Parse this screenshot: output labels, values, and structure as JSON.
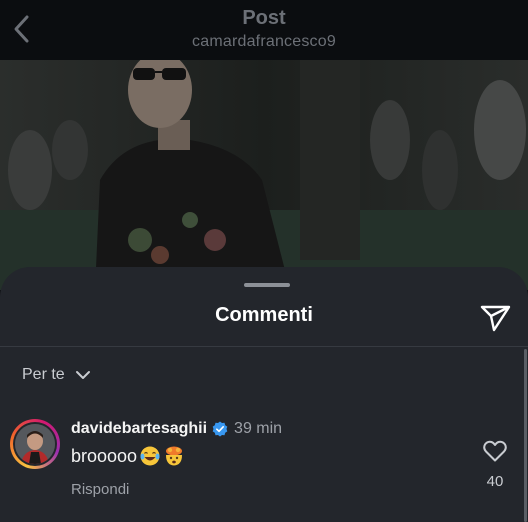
{
  "header": {
    "title": "Post",
    "subtitle": "camardafrancesco9",
    "back_icon": "chevron-left-icon"
  },
  "comments_sheet": {
    "title": "Commenti",
    "share_icon": "send-icon",
    "filter": {
      "label": "Per te",
      "icon": "chevron-down-icon"
    },
    "comments": [
      {
        "username": "davidebartesaghii",
        "verified": true,
        "time": "39 min",
        "text": "brooooo",
        "emojis": [
          "tears-of-joy-emoji",
          "exploding-head-emoji"
        ],
        "reply_label": "Rispondi",
        "like_count": "40"
      }
    ]
  },
  "colors": {
    "background": "#0c0e11",
    "sheet": "#23262c",
    "muted_text": "#9da1a8",
    "verified_badge": "#3897f0"
  }
}
